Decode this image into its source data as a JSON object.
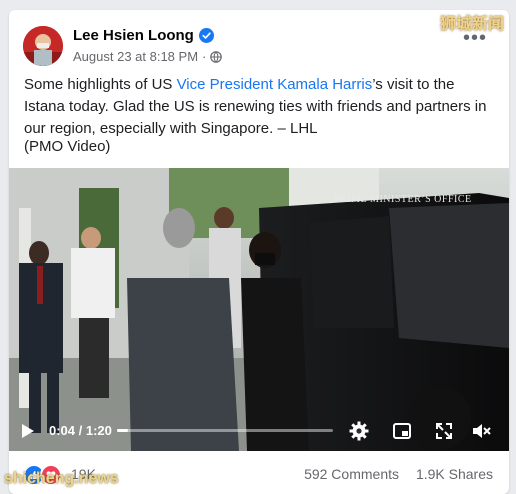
{
  "watermarks": {
    "top": "狮城新闻",
    "bottom": "shicheng.news"
  },
  "post": {
    "author": "Lee Hsien Loong",
    "date": "August 23 at 8:18 PM",
    "more_label": "•••",
    "caption_before": "Some highlights of US ",
    "caption_link": "Vice President Kamala Harris",
    "caption_after": "’s visit to the Istana today. Glad the US is renewing ties with friends and partners in our region, especially with Singapore. – LHL",
    "caption_note": "(PMO Video)"
  },
  "video": {
    "watermark": "PRIME MINISTER’S OFFICE",
    "current_time": "0:04",
    "separator": " / ",
    "duration": "1:20",
    "progress_fraction": 0.05,
    "icons": [
      "play-icon",
      "settings-icon",
      "pip-icon",
      "fullscreen-icon",
      "volume-icon"
    ]
  },
  "engagement": {
    "reaction_count": "19K",
    "comments": "592 Comments",
    "shares": "1.9K Shares"
  },
  "colors": {
    "link": "#1877f2",
    "verified": "#1877f2",
    "like": "#1877f2",
    "love": "#f33e58"
  }
}
